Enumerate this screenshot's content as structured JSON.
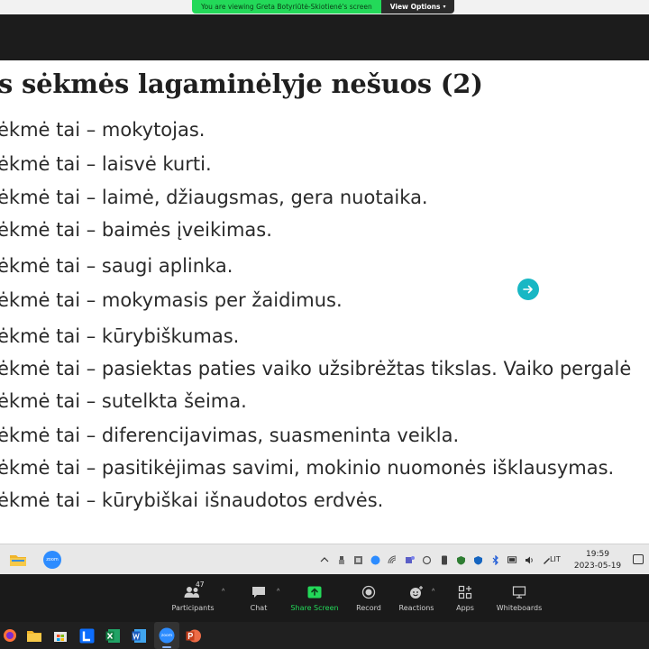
{
  "banner": {
    "viewing_text": "You are viewing Greta Botyriūtė-Skiotienė's screen",
    "view_options_label": "View Options"
  },
  "slide": {
    "title": "s sėkmės lagaminėlyje nešuos (2)",
    "lines": [
      "ėkmė tai –  mokytojas.",
      "ėkmė tai – laisvė kurti.",
      "ėkmė tai – laimė, džiaugsmas, gera nuotaika.",
      "ėkmė tai – baimės įveikimas.",
      "ėkmė tai – saugi aplinka.",
      "ėkmė tai – mokymasis per žaidimus.",
      "ėkmė tai –  kūrybiškumas.",
      "ėkmė tai – pasiektas paties vaiko užsibrėžtas tikslas. Vaiko pergalė",
      "ėkmė tai – sutelkta šeima.",
      "ėkmė tai – diferencijavimas, suasmeninta veikla.",
      "ėkmė tai – pasitikėjimas savimi, mokinio nuomonės išklausymas.",
      "ėkmė tai – kūrybiškai išnaudotos erdvės."
    ]
  },
  "remote_taskbar": {
    "zoom_app_text": "zoom",
    "language": "LIT",
    "time": "19:59",
    "date": "2023-05-19"
  },
  "zoom_controls": {
    "participants_count": "47",
    "participants_label": "Participants",
    "chat_label": "Chat",
    "share_screen_label": "Share Screen",
    "record_label": "Record",
    "reactions_label": "Reactions",
    "apps_label": "Apps",
    "whiteboards_label": "Whiteboards"
  },
  "local_taskbar": {
    "zoom_app_text": "zoom"
  },
  "colors": {
    "banner_green": "#23d959",
    "share_green": "#23d959",
    "cursor_teal": "#18b7c4",
    "dark_bg": "#1a1a1a"
  }
}
